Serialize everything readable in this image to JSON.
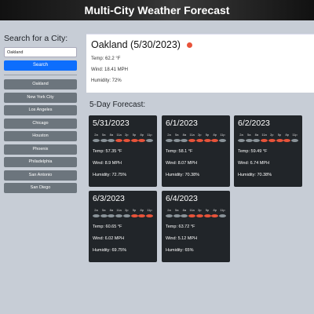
{
  "header": {
    "title": "Multi-City Weather Forecast"
  },
  "sidebar": {
    "search_label": "Search for a City:",
    "search_value": "Oakland",
    "search_button": "Search",
    "cities": [
      "Oakland",
      "New York City",
      "Los Angeles",
      "Chicago",
      "Houston",
      "Phoenix",
      "Philadelphia",
      "San Antonio",
      "San Diego"
    ]
  },
  "current": {
    "title": "Oakland (5/30/2023)",
    "icon": "sun-icon",
    "temp": "Temp: 62.2 °F",
    "wind": "Wind: 18.41 MPH",
    "humidity": "Humidity: 72%"
  },
  "forecast": {
    "title": "5-Day Forecast:",
    "hour_labels": [
      "2a",
      "5a",
      "8a",
      "11a",
      "2p",
      "5p",
      "8p",
      "11p"
    ],
    "days": [
      {
        "date": "5/31/2023",
        "temp": "Temp: 57.35 °F",
        "wind": "Wind: 8.9 MPH",
        "humidity": "Humidity: 72.75%",
        "hourly_icons": [
          "cloud",
          "cloud",
          "cloud",
          "sun",
          "sun",
          "sun",
          "sun",
          "cloud"
        ]
      },
      {
        "date": "6/1/2023",
        "temp": "Temp: 58.1 °F",
        "wind": "Wind: 8.07 MPH",
        "humidity": "Humidity: 70.38%",
        "hourly_icons": [
          "cloud",
          "cloud",
          "cloud",
          "sun",
          "sun",
          "sun",
          "sun",
          "cloud"
        ]
      },
      {
        "date": "6/2/2023",
        "temp": "Temp: 59.49 °F",
        "wind": "Wind: 6.74 MPH",
        "humidity": "Humidity: 70.38%",
        "hourly_icons": [
          "cloud",
          "cloud",
          "cloud",
          "sun",
          "sun",
          "sun",
          "sun",
          "cloud"
        ]
      },
      {
        "date": "6/3/2023",
        "temp": "Temp: 60.65 °F",
        "wind": "Wind: 6.02 MPH",
        "humidity": "Humidity: 69.75%",
        "hourly_icons": [
          "cloud",
          "cloud",
          "cloud",
          "cloud",
          "cloud",
          "sun",
          "sun",
          "sun"
        ]
      },
      {
        "date": "6/4/2023",
        "temp": "Temp: 63.72 °F",
        "wind": "Wind: 5.12 MPH",
        "humidity": "Humidity: 65%",
        "hourly_icons": [
          "cloud",
          "cloud",
          "cloud",
          "sun",
          "sun",
          "sun",
          "sun",
          "cloud"
        ]
      }
    ]
  },
  "colors": {
    "header_bg": "#222222",
    "search_button": "#0d6efd",
    "city_button": "#6c757d",
    "card_bg": "#212529",
    "sun": "#e8533a",
    "cloud": "#8a9399"
  }
}
